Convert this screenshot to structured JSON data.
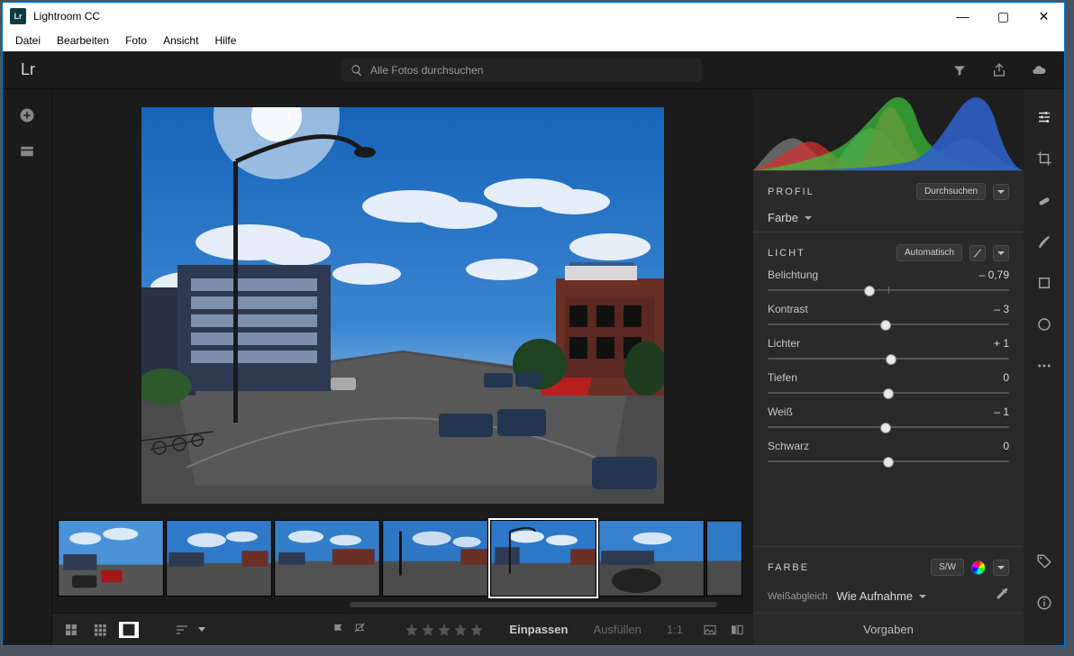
{
  "window": {
    "title": "Lightroom CC"
  },
  "menubar": [
    "Datei",
    "Bearbeiten",
    "Foto",
    "Ansicht",
    "Hilfe"
  ],
  "brand": "Lr",
  "search": {
    "placeholder": "Alle Fotos durchsuchen"
  },
  "edit": {
    "profil": {
      "title": "PROFIL",
      "browse": "Durchsuchen",
      "value": "Farbe"
    },
    "licht": {
      "title": "LICHT",
      "auto": "Automatisch",
      "sliders": [
        {
          "label": "Belichtung",
          "value": "– 0,79",
          "pos": 42
        },
        {
          "label": "Kontrast",
          "value": "– 3",
          "pos": 49
        },
        {
          "label": "Lichter",
          "value": "+ 1",
          "pos": 51
        },
        {
          "label": "Tiefen",
          "value": "0",
          "pos": 50
        },
        {
          "label": "Weiß",
          "value": "– 1",
          "pos": 49
        },
        {
          "label": "Schwarz",
          "value": "0",
          "pos": 50
        }
      ]
    },
    "farbe": {
      "title": "FARBE",
      "sw": "S/W",
      "wb_label": "Weißabgleich",
      "wb_value": "Wie Aufnahme"
    },
    "vorgaben": "Vorgaben"
  },
  "bottom": {
    "fit": "Einpassen",
    "fill": "Ausfüllen",
    "one": "1:1"
  }
}
